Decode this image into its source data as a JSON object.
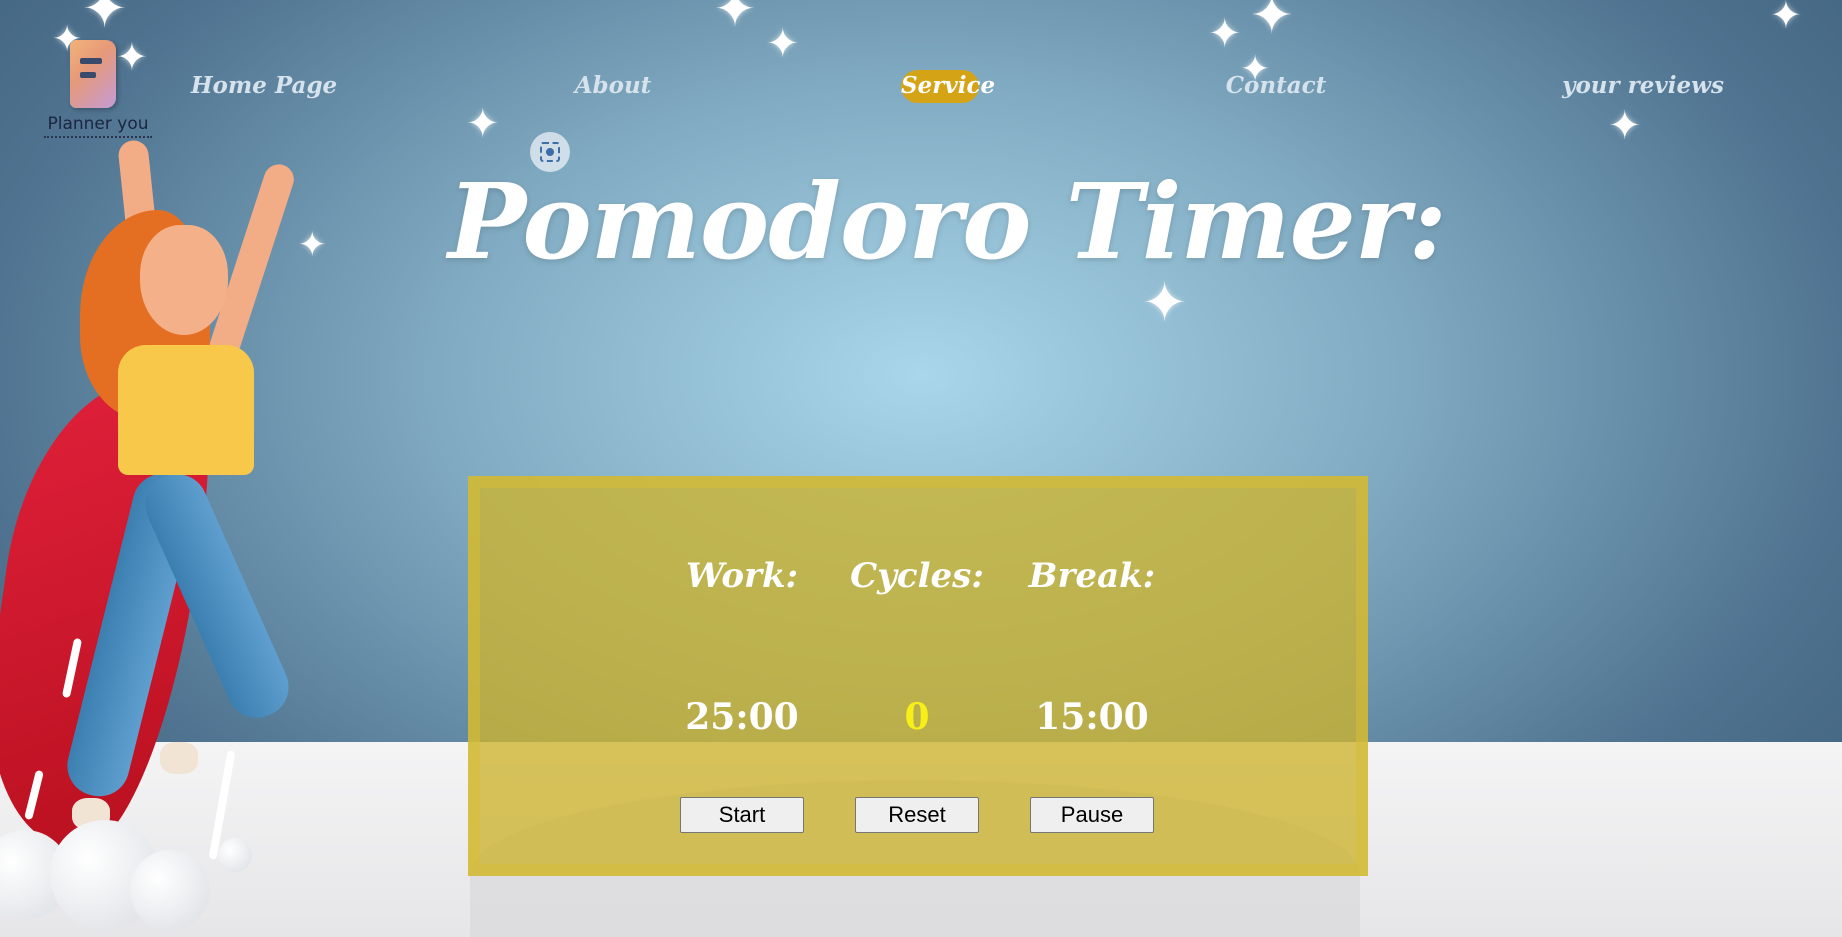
{
  "logo": {
    "text": "Planner you"
  },
  "nav": {
    "items": [
      {
        "label": "Home Page",
        "active": false
      },
      {
        "label": "About",
        "active": false
      },
      {
        "label": "Service",
        "active": true
      },
      {
        "label": "Contact",
        "active": false
      },
      {
        "label": "your reviews",
        "active": false
      }
    ]
  },
  "page": {
    "title": "Pomodoro Timer:"
  },
  "timer": {
    "work_label": "Work:",
    "cycles_label": "Cycles:",
    "break_label": "Break:",
    "work_value": "25:00",
    "cycles_value": "0",
    "break_value": "15:00",
    "start_label": "Start",
    "reset_label": "Reset",
    "pause_label": "Pause"
  },
  "colors": {
    "accent": "#d4a416",
    "panel": "#cdb42d",
    "cycles_value": "#f7ef18"
  },
  "icons": {
    "screenshot": "screenshot-capture-icon",
    "star": "sparkle-star-icon"
  }
}
